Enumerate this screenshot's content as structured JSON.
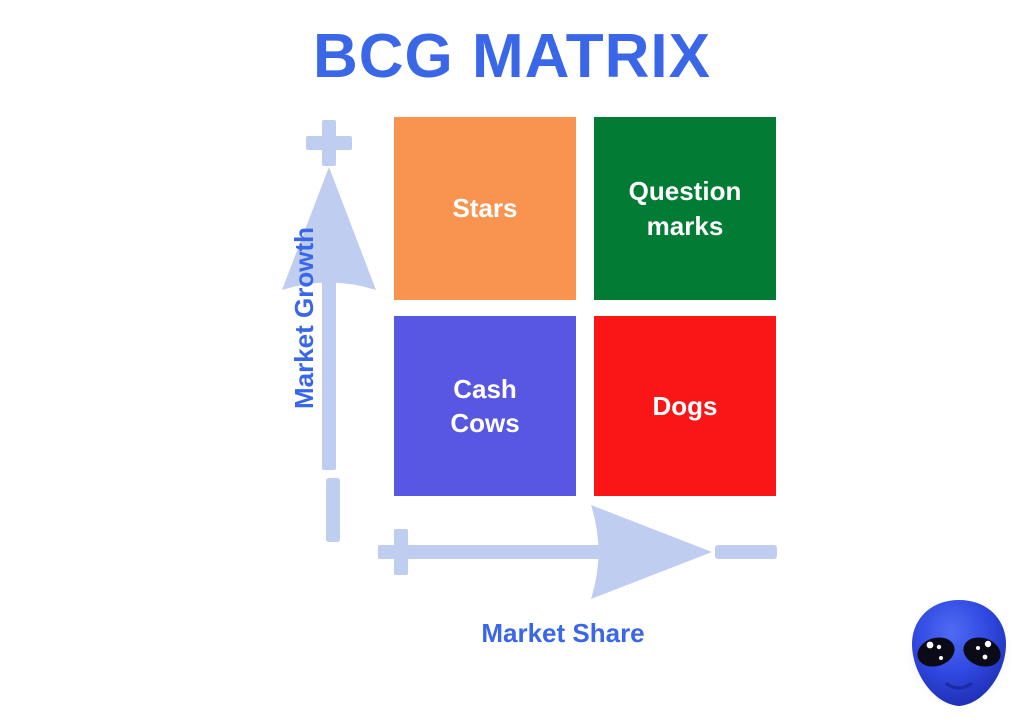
{
  "title": "BCG MATRIX",
  "theme": {
    "title_color": "#3a66e8",
    "axis_color": "#bfcdf0",
    "axis_label_color": "#3a66e8",
    "background": "#ffffff",
    "quadrant_text_color": "#ffffff"
  },
  "quadrants": [
    {
      "key": "stars",
      "label": "Stars",
      "color": "#f89350",
      "position": "top-left",
      "market_growth": "+",
      "market_share": "+"
    },
    {
      "key": "question-marks",
      "label": "Question\nmarks",
      "label_line1": "Question",
      "label_line2": "marks",
      "color": "#027c35",
      "position": "top-right",
      "market_growth": "+",
      "market_share": "-"
    },
    {
      "key": "cash-cows",
      "label": "Cash\nCows",
      "label_line1": "Cash",
      "label_line2": "Cows",
      "color": "#5757e3",
      "position": "bottom-left",
      "market_growth": "-",
      "market_share": "+"
    },
    {
      "key": "dogs",
      "label": "Dogs",
      "color": "#fa1616",
      "position": "bottom-right",
      "market_growth": "-",
      "market_share": "-"
    }
  ],
  "axes": {
    "vertical": {
      "label": "Market Growth",
      "positive_sign": "+",
      "negative_sign": "–",
      "direction": "up"
    },
    "horizontal": {
      "label": "Market Share",
      "positive_sign": "+",
      "negative_sign": "–",
      "direction": "right"
    }
  },
  "alien": {
    "icon": "alien-face-icon",
    "head_color": "#2b41d8",
    "head_highlight": "#4a63f0",
    "eye_color": "#0b0b18"
  }
}
